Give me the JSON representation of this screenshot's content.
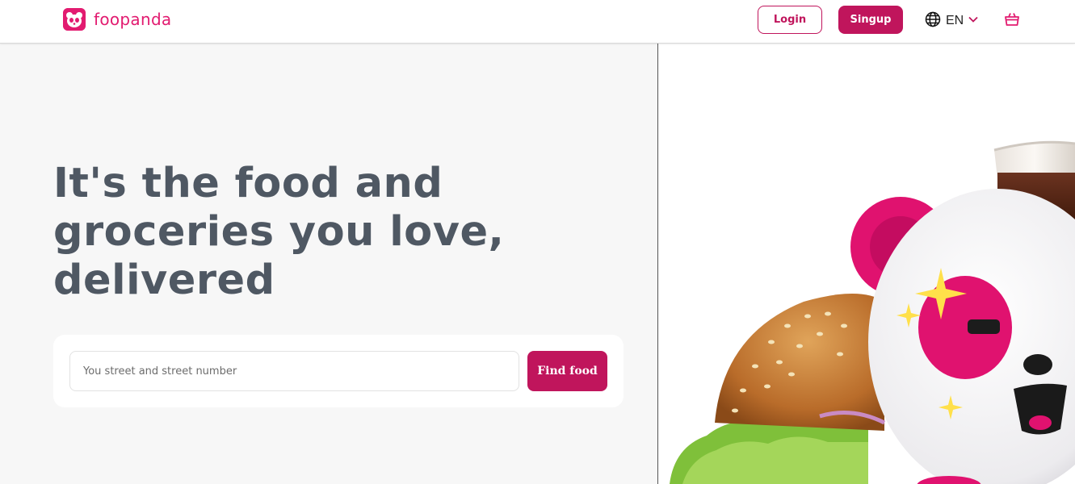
{
  "header": {
    "brand": "foopanda",
    "login_label": "Login",
    "signup_label": "Singup",
    "language": "EN"
  },
  "hero": {
    "title": "It's the food and groceries you love, delivered"
  },
  "search": {
    "placeholder": "You street and street number",
    "value": "",
    "button_label": "Find food"
  },
  "icons": {
    "logo": "panda-logo-icon",
    "language": "globe-icon",
    "language_caret": "chevron-down-icon",
    "cart": "basket-icon"
  },
  "colors": {
    "brand": "#e21b70",
    "button": "#c0155c",
    "hero_text": "#4f5863",
    "left_background": "#f7f7f7"
  }
}
